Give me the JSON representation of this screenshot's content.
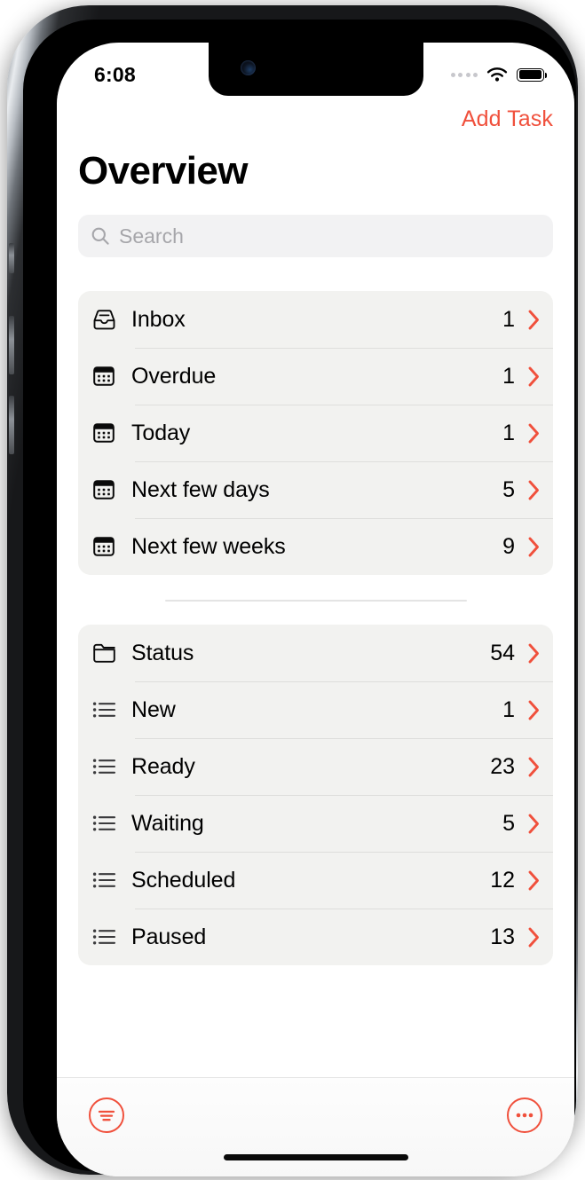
{
  "status_bar": {
    "time": "6:08",
    "signal_icon": "signal-dots-icon",
    "wifi_icon": "wifi-icon",
    "battery_icon": "battery-full-icon"
  },
  "nav": {
    "add_task_label": "Add Task"
  },
  "header": {
    "title": "Overview"
  },
  "search": {
    "placeholder": "Search",
    "value": "",
    "icon": "search-icon"
  },
  "colors": {
    "accent": "#F0503C",
    "group_background": "#f2f2f0",
    "search_background": "#f2f2f3",
    "separator": "#dededc",
    "text_primary": "#000000",
    "placeholder": "#a6a6aa"
  },
  "groups": [
    {
      "id": "date-group",
      "rows": [
        {
          "label": "Inbox",
          "count": "1",
          "icon": "inbox-tray-icon"
        },
        {
          "label": "Overdue",
          "count": "1",
          "icon": "calendar-icon"
        },
        {
          "label": "Today",
          "count": "1",
          "icon": "calendar-icon"
        },
        {
          "label": "Next few days",
          "count": "5",
          "icon": "calendar-icon"
        },
        {
          "label": "Next few weeks",
          "count": "9",
          "icon": "calendar-icon"
        }
      ]
    },
    {
      "id": "status-group",
      "rows": [
        {
          "label": "Status",
          "count": "54",
          "icon": "folder-icon"
        },
        {
          "label": "New",
          "count": "1",
          "icon": "list-bullet-icon"
        },
        {
          "label": "Ready",
          "count": "23",
          "icon": "list-bullet-icon"
        },
        {
          "label": "Waiting",
          "count": "5",
          "icon": "list-bullet-icon"
        },
        {
          "label": "Scheduled",
          "count": "12",
          "icon": "list-bullet-icon"
        },
        {
          "label": "Paused",
          "count": "13",
          "icon": "list-bullet-icon"
        }
      ]
    }
  ],
  "toolbar": {
    "filter_icon": "filter-lines-circle-icon",
    "more_icon": "ellipsis-circle-icon"
  }
}
